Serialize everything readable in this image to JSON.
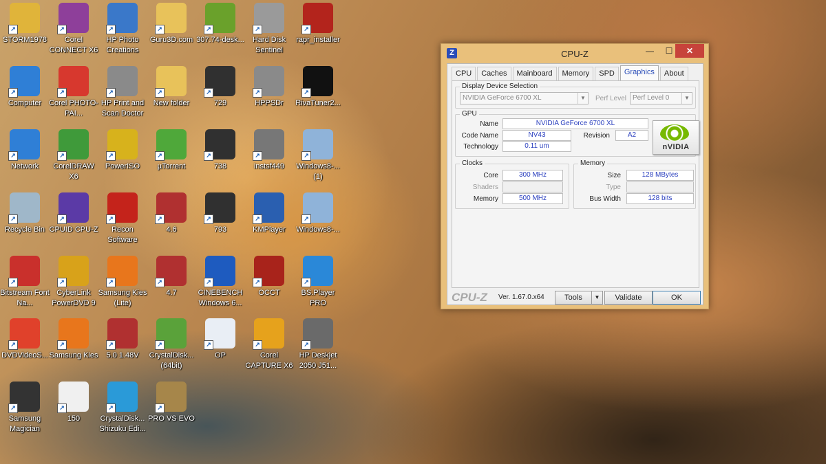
{
  "desktop": {
    "icons": [
      {
        "label": "STORM1978",
        "icon": "user-folder-icon",
        "color": "#e0b43a"
      },
      {
        "label": "Corel CONNECT X6",
        "icon": "corel-connect-icon",
        "color": "#8e3f9a"
      },
      {
        "label": "HP Photo Creations",
        "icon": "hp-photo-icon",
        "color": "#3a78c9"
      },
      {
        "label": "Guru3D.com",
        "icon": "folder-icon",
        "color": "#e8c25a"
      },
      {
        "label": "307.74-desk...",
        "icon": "nvidia-installer-icon",
        "color": "#6aa12b"
      },
      {
        "label": "Hard Disk Sentinel",
        "icon": "hard-disk-sentinel-icon",
        "color": "#9a9a9a"
      },
      {
        "label": "rapr_installer",
        "icon": "rapr-installer-icon",
        "color": "#b3241c"
      },
      {
        "label": "Computer",
        "icon": "computer-icon",
        "color": "#2f7fd6"
      },
      {
        "label": "Corel PHOTO-PAI...",
        "icon": "corel-photopaint-icon",
        "color": "#d7382e"
      },
      {
        "label": "HP Print and Scan Doctor",
        "icon": "hp-print-scan-icon",
        "color": "#8a8a8a"
      },
      {
        "label": "New folder",
        "icon": "folder-icon",
        "color": "#e8c25a"
      },
      {
        "label": "729",
        "icon": "image-file-icon",
        "color": "#303030"
      },
      {
        "label": "HPPSDr",
        "icon": "hppsdr-icon",
        "color": "#8a8a8a"
      },
      {
        "label": "RivaTuner2...",
        "icon": "7z-archive-icon",
        "color": "#111111"
      },
      {
        "label": "Network",
        "icon": "network-icon",
        "color": "#2f7fd6"
      },
      {
        "label": "CorelDRAW X6",
        "icon": "coreldraw-icon",
        "color": "#3f9a3a"
      },
      {
        "label": "PowerISO",
        "icon": "poweriso-icon",
        "color": "#d7b21c"
      },
      {
        "label": "µTorrent",
        "icon": "utorrent-icon",
        "color": "#4fa83a"
      },
      {
        "label": "738",
        "icon": "image-file-icon",
        "color": "#303030"
      },
      {
        "label": "instsf449",
        "icon": "installer-icon",
        "color": "#777777"
      },
      {
        "label": "Windows8-... (1)",
        "icon": "windows-package-icon",
        "color": "#8fb3d9"
      },
      {
        "label": "Recycle Bin",
        "icon": "recycle-bin-icon",
        "color": "#9fb7c9"
      },
      {
        "label": "CPUID CPU-Z",
        "icon": "cpuz-icon",
        "color": "#5b3aa6"
      },
      {
        "label": "Recon Software",
        "icon": "recon-software-icon",
        "color": "#c4231b"
      },
      {
        "label": "4.6",
        "icon": "image-file-icon",
        "color": "#b03030"
      },
      {
        "label": "793",
        "icon": "image-file-icon",
        "color": "#303030"
      },
      {
        "label": "KMPlayer",
        "icon": "kmplayer-icon",
        "color": "#2a5fb0"
      },
      {
        "label": "Windows8-...",
        "icon": "windows-package-icon",
        "color": "#8fb3d9"
      },
      {
        "label": "Bitstream Font Na...",
        "icon": "bitstream-font-icon",
        "color": "#c9302c"
      },
      {
        "label": "CyberLink PowerDVD 9",
        "icon": "powerdvd-icon",
        "color": "#d8a21a"
      },
      {
        "label": "Samsung Kies (Lite)",
        "icon": "samsung-kies-lite-icon",
        "color": "#e8761c"
      },
      {
        "label": "4.7",
        "icon": "image-file-icon",
        "color": "#b03030"
      },
      {
        "label": "CINEBENCH Windows 6...",
        "icon": "cinebench-icon",
        "color": "#1e5bbf"
      },
      {
        "label": "OCCT",
        "icon": "occt-icon",
        "color": "#a8231b"
      },
      {
        "label": "BS.Player PRO",
        "icon": "bsplayer-icon",
        "color": "#2a88d8"
      },
      {
        "label": "DVDVideoS...",
        "icon": "dvdvideosoft-icon",
        "color": "#e0412b"
      },
      {
        "label": "Samsung Kies",
        "icon": "samsung-kies-icon",
        "color": "#e8761c"
      },
      {
        "label": "5.0 1.48V",
        "icon": "image-file-icon",
        "color": "#b03030"
      },
      {
        "label": "CrystalDisk... (64bit)",
        "icon": "crystaldisk-icon",
        "color": "#5aa23a"
      },
      {
        "label": "OP",
        "icon": "image-file-icon",
        "color": "#e9eef5"
      },
      {
        "label": "Corel CAPTURE X6",
        "icon": "corel-capture-icon",
        "color": "#e6a21c"
      },
      {
        "label": "HP Deskjet 2050 J51...",
        "icon": "printer-icon",
        "color": "#6a6a6a"
      },
      {
        "label": "Samsung Magician",
        "icon": "samsung-magician-icon",
        "color": "#333333"
      },
      {
        "label": "150",
        "icon": "image-file-icon",
        "color": "#f0f0f0"
      },
      {
        "label": "CrystalDisk... Shizuku Edi...",
        "icon": "crystaldisk-shizuku-icon",
        "color": "#2a9ad8"
      },
      {
        "label": "PRO VS EVO",
        "icon": "image-file-icon",
        "color": "#a6864a"
      }
    ]
  },
  "cpuz": {
    "title": "CPU-Z",
    "app_icon": "Z",
    "window_buttons": {
      "min": "—",
      "max": "☐",
      "close": "✕"
    },
    "tabs": [
      "CPU",
      "Caches",
      "Mainboard",
      "Memory",
      "SPD",
      "Graphics",
      "About"
    ],
    "active_tab": "Graphics",
    "display_selection": {
      "legend": "Display Device Selection",
      "device": "NVIDIA GeForce 6700 XL",
      "perf_label": "Perf Level",
      "perf_value": "Perf Level 0"
    },
    "gpu": {
      "legend": "GPU",
      "name_label": "Name",
      "name": "NVIDIA GeForce 6700 XL",
      "code_label": "Code Name",
      "code": "NV43",
      "revision_label": "Revision",
      "revision": "A2",
      "tech_label": "Technology",
      "tech": "0.11 um",
      "logo_text": "nVIDIA"
    },
    "clocks": {
      "legend": "Clocks",
      "core_label": "Core",
      "core": "300 MHz",
      "shaders_label": "Shaders",
      "shaders": "",
      "memory_label": "Memory",
      "memory": "500 MHz"
    },
    "memory": {
      "legend": "Memory",
      "size_label": "Size",
      "size": "128 MBytes",
      "type_label": "Type",
      "type": "",
      "bus_label": "Bus Width",
      "bus": "128 bits"
    },
    "footer": {
      "brand": "CPU-Z",
      "version": "Ver. 1.67.0.x64",
      "tools": "Tools",
      "validate": "Validate",
      "ok": "OK"
    }
  }
}
